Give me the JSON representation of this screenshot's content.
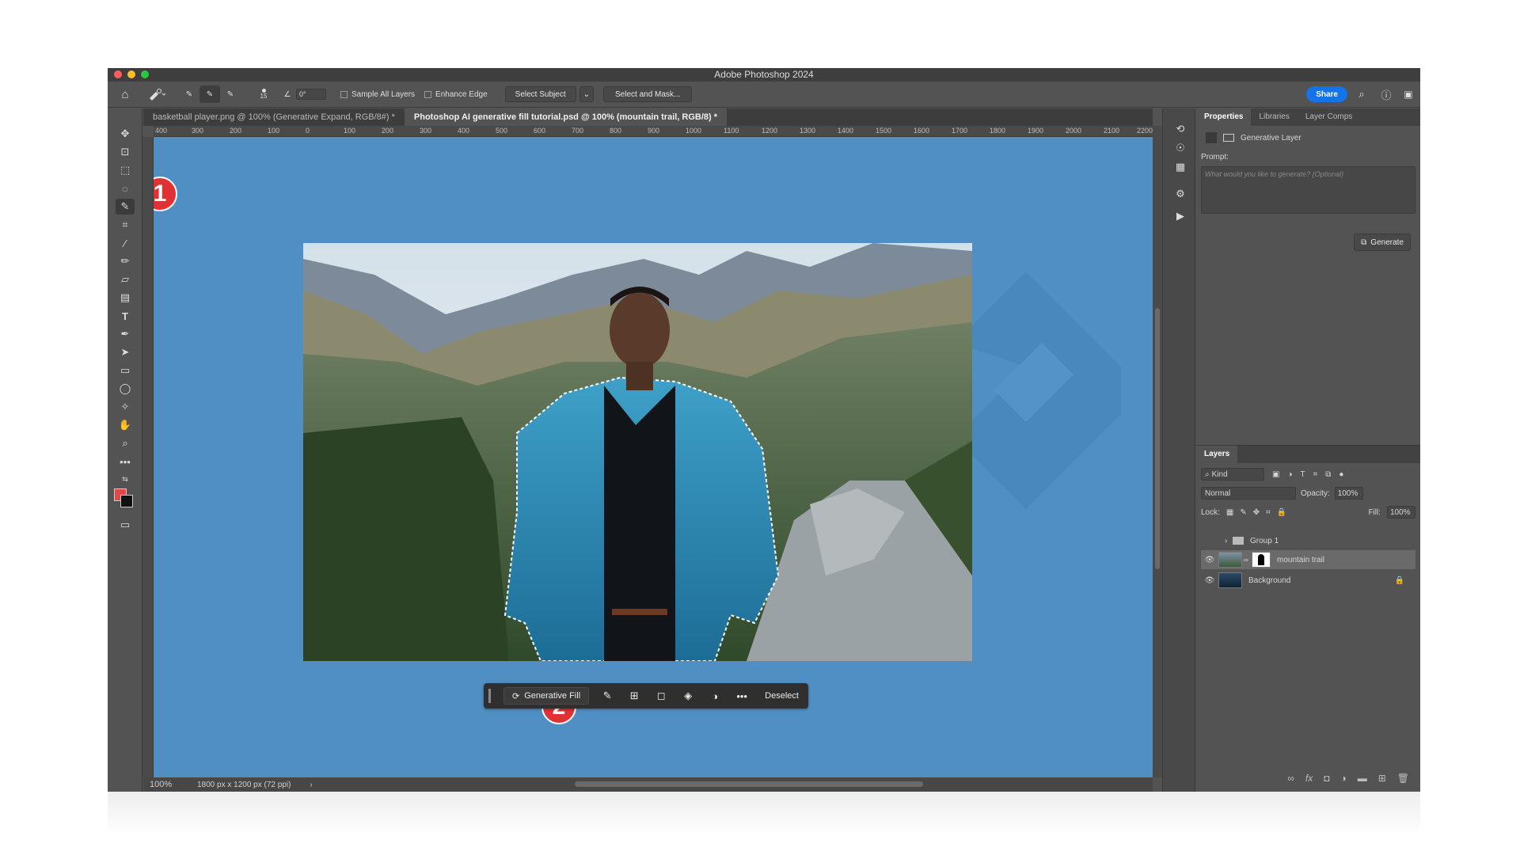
{
  "window": {
    "title": "Adobe Photoshop 2024"
  },
  "options_bar": {
    "brush_size": "15",
    "angle": "0°",
    "sample_all_layers": "Sample All Layers",
    "enhance_edge": "Enhance Edge",
    "select_subject": "Select Subject",
    "select_and_mask": "Select and Mask...",
    "share": "Share"
  },
  "doc_tabs": [
    {
      "label": "basketball player.png @ 100% (Generative Expand, RGB/8#) *"
    },
    {
      "label": "Photoshop AI generative fill tutorial.psd @ 100% (mountain trail, RGB/8) *"
    }
  ],
  "ruler": {
    "ticks": [
      "400",
      "300",
      "200",
      "100",
      "0",
      "100",
      "200",
      "300",
      "400",
      "500",
      "600",
      "700",
      "800",
      "900",
      "1000",
      "1100",
      "1200",
      "1300",
      "1400",
      "1500",
      "1600",
      "1700",
      "1800",
      "1900",
      "2000",
      "2100",
      "2200"
    ]
  },
  "contextual_taskbar": {
    "generative_fill": "Generative Fill",
    "deselect": "Deselect"
  },
  "badges": [
    "1",
    "2"
  ],
  "status": {
    "zoom": "100%",
    "doc_size": "1800 px x 1200 px (72 ppi)"
  },
  "properties": {
    "tabs": [
      "Properties",
      "Libraries",
      "Layer Comps"
    ],
    "layer_type": "Generative Layer",
    "prompt_label": "Prompt:",
    "prompt_placeholder": "What would you like to generate? (Optional)",
    "generate": "Generate"
  },
  "layers": {
    "title": "Layers",
    "kind": "Kind",
    "blend": "Normal",
    "opacity_label": "Opacity:",
    "opacity": "100%",
    "lock_label": "Lock:",
    "fill_label": "Fill:",
    "fill": "100%",
    "items": [
      {
        "name": "Group 1"
      },
      {
        "name": "mountain trail"
      },
      {
        "name": "Background"
      }
    ]
  },
  "colors": {
    "canvas_bg": "#4f8fc4",
    "accent": "#1473e6",
    "badge": "#e03234"
  }
}
